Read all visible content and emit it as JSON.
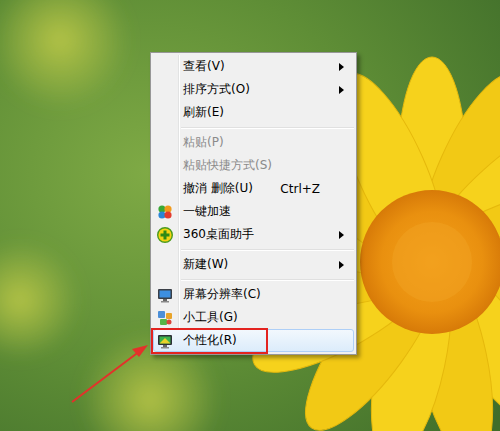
{
  "menu": {
    "items": [
      {
        "kind": "item",
        "label": "查看(V)",
        "disabled": false,
        "submenu": true,
        "selected": false,
        "annotated": false
      },
      {
        "kind": "item",
        "label": "排序方式(O)",
        "disabled": false,
        "submenu": true,
        "selected": false,
        "annotated": false
      },
      {
        "kind": "item",
        "label": "刷新(E)",
        "disabled": false,
        "submenu": false,
        "selected": false,
        "annotated": false
      },
      {
        "kind": "separator"
      },
      {
        "kind": "item",
        "label": "粘贴(P)",
        "disabled": true,
        "submenu": false,
        "selected": false,
        "annotated": false
      },
      {
        "kind": "item",
        "label": "粘贴快捷方式(S)",
        "disabled": true,
        "submenu": false,
        "selected": false,
        "annotated": false
      },
      {
        "kind": "item",
        "label": "撤消 删除(U)",
        "shortcut": "Ctrl+Z",
        "disabled": false,
        "submenu": false,
        "selected": false,
        "annotated": false
      },
      {
        "kind": "item",
        "label": "一键加速",
        "disabled": false,
        "submenu": false,
        "selected": false,
        "annotated": false
      },
      {
        "kind": "item",
        "label": "360桌面助手",
        "disabled": false,
        "submenu": true,
        "selected": false,
        "annotated": false
      },
      {
        "kind": "separator"
      },
      {
        "kind": "item",
        "label": "新建(W)",
        "disabled": false,
        "submenu": true,
        "selected": false,
        "annotated": false
      },
      {
        "kind": "separator"
      },
      {
        "kind": "item",
        "label": "屏幕分辨率(C)",
        "disabled": false,
        "submenu": false,
        "selected": false,
        "annotated": false
      },
      {
        "kind": "item",
        "label": "小工具(G)",
        "disabled": false,
        "submenu": false,
        "selected": false,
        "annotated": false
      },
      {
        "kind": "item",
        "label": "个性化(R)",
        "disabled": false,
        "submenu": false,
        "selected": true,
        "annotated": true
      }
    ]
  }
}
